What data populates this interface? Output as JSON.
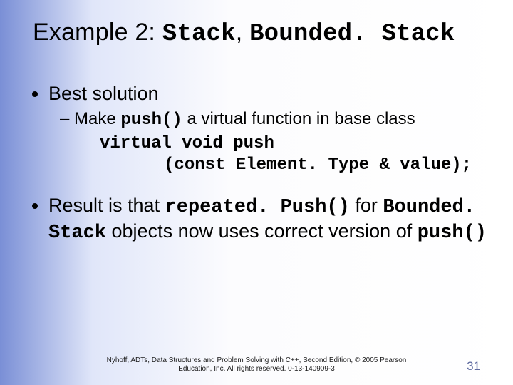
{
  "title": {
    "prefix": "Example 2: ",
    "code1": "Stack",
    "sep": ", ",
    "code2": "Bounded. Stack"
  },
  "bullet1": {
    "text": "Best solution",
    "sub": {
      "before": "Make ",
      "code_push": "push()",
      "after": " a virtual function in base class"
    },
    "codeblock_line1": "virtual void push",
    "codeblock_line2": "     (const Element. Type & value);"
  },
  "bullet2": {
    "t1": "Result is that ",
    "c_repeated": "repeated. Push()",
    "t2": " for ",
    "c_bounded": "Bounded. Stack",
    "t3": " objects now uses correct version of ",
    "c_push": "push()"
  },
  "footer": {
    "line1": "Nyhoff, ADTs, Data Structures and Problem Solving with C++, Second Edition, © 2005 Pearson",
    "line2": "Education, Inc. All rights reserved. 0-13-140909-3"
  },
  "page_number": "31"
}
